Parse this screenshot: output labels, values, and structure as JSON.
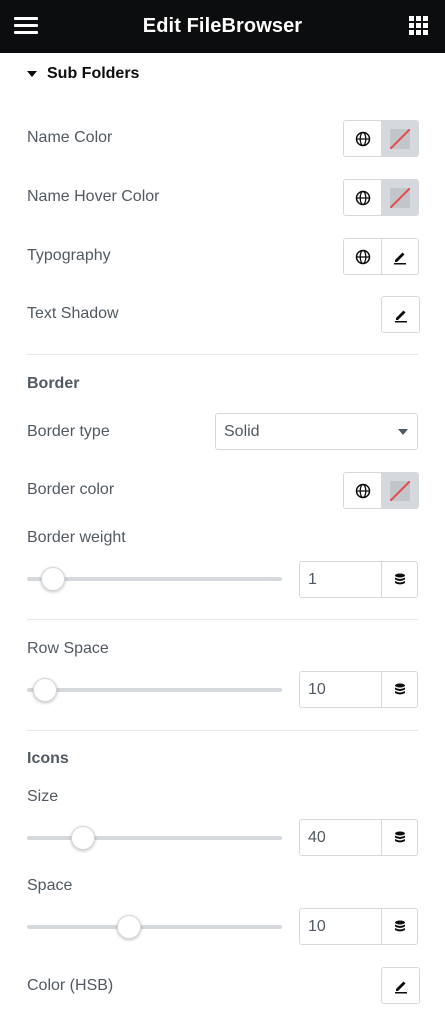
{
  "header": {
    "title": "Edit FileBrowser",
    "menu_icon": "hamburger-icon",
    "apps_icon": "grid-icon"
  },
  "section": {
    "title": "Sub Folders",
    "state": "expanded"
  },
  "controls": {
    "name_color": {
      "label": "Name Color",
      "value": "none"
    },
    "name_hover_color": {
      "label": "Name Hover Color",
      "value": "none"
    },
    "typography": {
      "label": "Typography"
    },
    "text_shadow": {
      "label": "Text Shadow"
    },
    "border_heading": "Border",
    "border_type": {
      "label": "Border type",
      "value": "Solid"
    },
    "border_color": {
      "label": "Border color",
      "value": "none"
    },
    "border_weight": {
      "label": "Border weight",
      "value": "1",
      "level": 0.1
    },
    "row_space": {
      "label": "Row Space",
      "value": "10",
      "level": 0.07
    },
    "icons_heading": "Icons",
    "icon_size": {
      "label": "Size",
      "value": "40",
      "level": 0.22
    },
    "icon_space": {
      "label": "Space",
      "value": "10",
      "level": 0.4
    },
    "icon_color": {
      "label": "Color (HSB)"
    }
  },
  "icons": {
    "global": "globe-icon",
    "edit": "pencil-icon",
    "units": "database-icon",
    "empty_color": "no-color-swatch"
  },
  "colors": {
    "header_bg": "#0c0d0e",
    "text": "#515962",
    "border": "#d5d8dc",
    "no_color_slash": "#e64a4a"
  }
}
